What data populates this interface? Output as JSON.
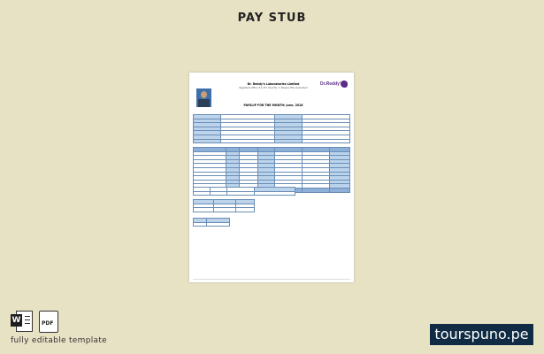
{
  "page": {
    "title": "PAY STUB"
  },
  "payslip": {
    "company": "Dr. Reddy's Laboratories Limited",
    "address": "Registered Office: 8-2-337, Road No. 3, Banjara Hills, Hyderabad",
    "logo_text": "Dr.Reddy's",
    "heading": "PAYSLIP FOR THE MONTH: June, 2018"
  },
  "footer": {
    "caption": "fully editable template",
    "brand": "tourspuno.pe",
    "word_icon_letter": "W",
    "pdf_icon_text": "PDF"
  },
  "colors": {
    "background": "#e8e2c5",
    "brand_bg": "#0f2c44",
    "table_accent": "#bcd3ec"
  }
}
